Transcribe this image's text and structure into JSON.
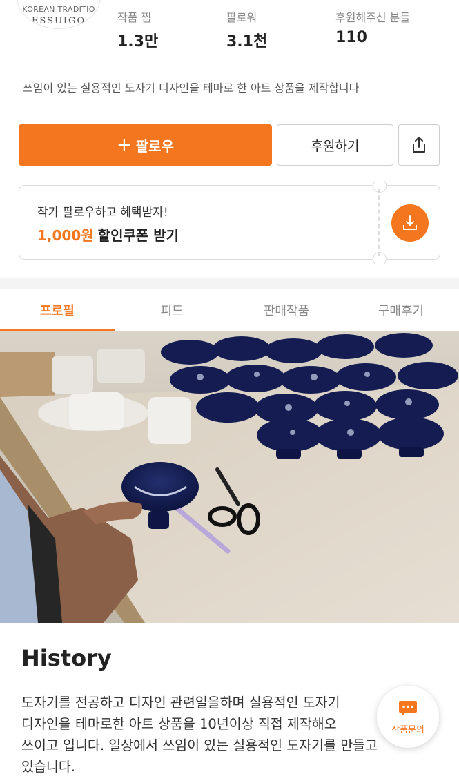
{
  "profile": {
    "logo_text_top": "KOREAN TRADITIO",
    "logo_text_bottom": "ESSUIGO"
  },
  "stats": [
    {
      "label": "작품 찜",
      "value": "1.3만"
    },
    {
      "label": "팔로워",
      "value": "3.1천"
    },
    {
      "label": "후원해주신 분들",
      "value": "110"
    }
  ],
  "description": "쓰임이 있는 실용적인 도자기 디자인을 테마로 한 아트 상품을 제작합니다",
  "actions": {
    "follow_plus": "+",
    "follow_label": "팔로우",
    "sponsor_label": "후원하기",
    "share_icon": "share-icon"
  },
  "coupon": {
    "line1": "작가 팔로우하고 혜택받자!",
    "amount": "1,000원",
    "line2_rest": "할인쿠폰 받기",
    "icon": "download-icon"
  },
  "tabs": [
    {
      "label": "프로필",
      "active": true
    },
    {
      "label": "피드",
      "active": false
    },
    {
      "label": "판매작품",
      "active": false
    },
    {
      "label": "구매후기",
      "active": false
    }
  ],
  "history": {
    "title": "History",
    "lines": [
      "도자기를 전공하고 디자인 관련일을하며  실용적인 도자기",
      "디자인을 테마로한 아트 상품을 10년이상 직접 제작해오",
      "쓰이고 입니다. 일상에서 쓰임이 있는 실용적인 도자기를 만들고",
      "있습니다."
    ]
  },
  "fab": {
    "label": "작품문의",
    "icon": "chat-icon"
  },
  "colors": {
    "accent": "#f47720",
    "text": "#222222",
    "muted": "#888888",
    "border": "#dcdcdc"
  }
}
